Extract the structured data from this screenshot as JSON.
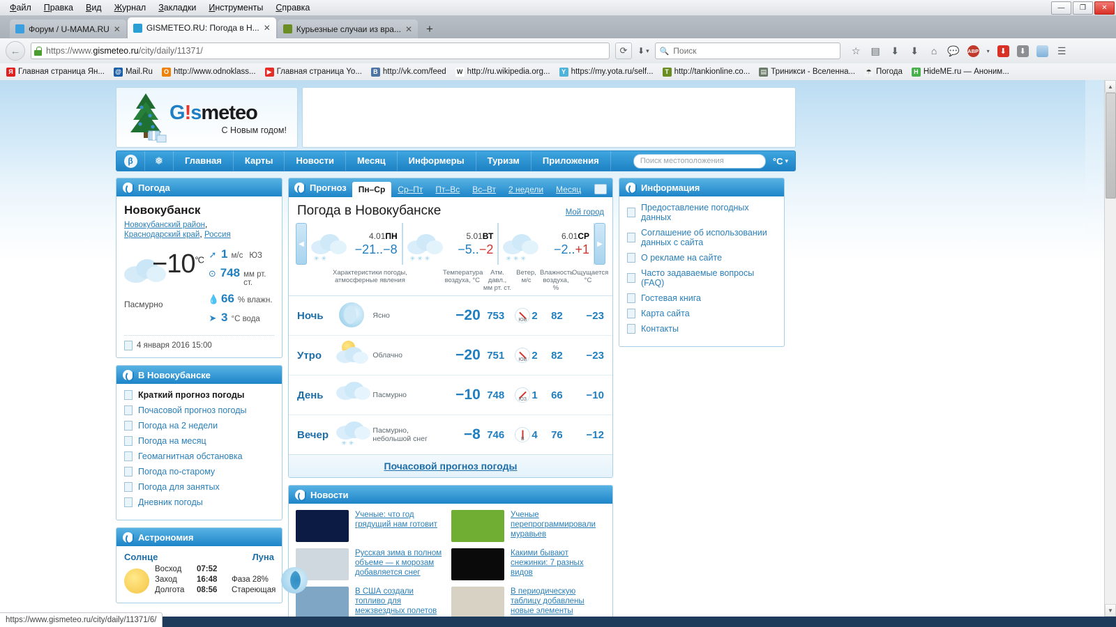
{
  "browser": {
    "menu": [
      "Файл",
      "Правка",
      "Вид",
      "Журнал",
      "Закладки",
      "Инструменты",
      "Справка"
    ],
    "window_buttons": {
      "minimize": "—",
      "maximize": "❐",
      "close": "✕"
    },
    "tabs": [
      {
        "title": "Форум / U-MAMA.RU",
        "active": false,
        "close": "✕"
      },
      {
        "title": "GISMETEO.RU: Погода в Н...",
        "active": true,
        "close": "✕"
      },
      {
        "title": "Курьезные случаи из вра...",
        "active": false,
        "close": "✕"
      }
    ],
    "new_tab_label": "+",
    "url_prefix": "https://www.",
    "url_domain": "gismeteo.ru",
    "url_path": "/city/daily/11371/",
    "reload_glyph": "⟳",
    "search_placeholder": "Поиск",
    "bookmarks": [
      {
        "label": "Главная страница Ян...",
        "badge": "Я",
        "color": "#e02020"
      },
      {
        "label": "Mail.Ru",
        "badge": "@",
        "color": "#1a5fa8"
      },
      {
        "label": "http://www.odnoklass...",
        "badge": "О",
        "color": "#ee8208"
      },
      {
        "label": "Главная страница Yo...",
        "badge": "▶",
        "color": "#e52d27"
      },
      {
        "label": "http://vk.com/feed",
        "badge": "B",
        "color": "#4c75a3"
      },
      {
        "label": "http://ru.wikipedia.org...",
        "badge": "W",
        "color": "#ffffff"
      },
      {
        "label": "https://my.yota.ru/self...",
        "badge": "Y",
        "color": "#4fb3d9"
      },
      {
        "label": "http://tankionline.co...",
        "badge": "T",
        "color": "#6b8e23"
      },
      {
        "label": "Триникси - Вселенна...",
        "badge": "▤",
        "color": "#6b7b6b"
      },
      {
        "label": "Погода",
        "badge": "☂",
        "color": "#f2f2f2"
      },
      {
        "label": "HideME.ru — Аноним...",
        "badge": "H",
        "color": "#46b04a"
      }
    ],
    "status_url": "https://www.gismeteo.ru/city/daily/11371/6/"
  },
  "site": {
    "logo": {
      "brand_gis": "G",
      "brand_bang": "!",
      "brand_s": "s",
      "brand_meteo": "meteo",
      "slogan": "С Новым годом!"
    },
    "nav": {
      "icon_beta": "β",
      "icon_snow": "❅",
      "items": [
        "Главная",
        "Карты",
        "Новости",
        "Месяц",
        "Информеры",
        "Туризм",
        "Приложения"
      ],
      "search_placeholder": "Поиск местоположения",
      "units": "°C",
      "units_caret": "▾"
    }
  },
  "left": {
    "weather_panel": {
      "title": "Погода",
      "city": "Новокубанск",
      "region_links": [
        "Новокубанский район",
        "Краснодарский край",
        "Россия"
      ],
      "temperature": "−10",
      "temperature_unit": "°C",
      "condition": "Пасмурно",
      "metrics": [
        {
          "icon": "wind-arrow-icon",
          "glyph": "➚",
          "value": "1",
          "unit": "м/с",
          "extra": "ЮЗ"
        },
        {
          "icon": "pressure-icon",
          "glyph": "⊙",
          "value": "748",
          "unit": "мм рт. ст.",
          "extra": ""
        },
        {
          "icon": "humidity-drop-icon",
          "glyph": "💧",
          "value": "66",
          "unit": "% влажн.",
          "extra": ""
        },
        {
          "icon": "water-fish-icon",
          "glyph": "➤",
          "value": "3",
          "unit": "°C вода",
          "extra": ""
        }
      ],
      "observed_at": "4 января 2016 15:00"
    },
    "city_panel": {
      "title": "В Новокубанске",
      "items": [
        {
          "label": "Краткий прогноз погоды",
          "current": true
        },
        {
          "label": "Почасовой прогноз погоды",
          "current": false
        },
        {
          "label": "Погода на 2 недели",
          "current": false
        },
        {
          "label": "Погода на месяц",
          "current": false
        },
        {
          "label": "Геомагнитная обстановка",
          "current": false
        },
        {
          "label": "Погода по-старому",
          "current": false
        },
        {
          "label": "Погода для занятых",
          "current": false
        },
        {
          "label": "Дневник погоды",
          "current": false
        }
      ]
    },
    "astronomy_panel": {
      "title": "Астрономия",
      "sun_label": "Солнце",
      "moon_label": "Луна",
      "rows": [
        {
          "label": "Восход",
          "time": "07:52",
          "note": ""
        },
        {
          "label": "Заход",
          "time": "16:48",
          "note": "Фаза 28%"
        },
        {
          "label": "Долгота",
          "time": "08:56",
          "note": "Стареющая"
        }
      ]
    }
  },
  "center": {
    "panel_title": "Прогноз",
    "tabs": [
      {
        "label": "Пн–Ср",
        "active": true
      },
      {
        "label": "Ср–Пт",
        "active": false
      },
      {
        "label": "Пт–Вс",
        "active": false
      },
      {
        "label": "Вс–Вт",
        "active": false
      },
      {
        "label": "2 недели",
        "active": false
      },
      {
        "label": "Месяц",
        "active": false
      }
    ],
    "heading": "Погода в Новокубанске",
    "my_city_link": "Мой город",
    "prev_arrow": "◀",
    "next_arrow": "▶",
    "days": [
      {
        "date": "4.01",
        "dow": "ПН",
        "tmin": "−21",
        "sep": "..",
        "tmax": "−8",
        "tmax_warm": false
      },
      {
        "date": "5.01",
        "dow": "ВТ",
        "tmin": "−5",
        "sep": "..",
        "tmax": "−2",
        "tmax_warm": true
      },
      {
        "date": "6.01",
        "dow": "СР",
        "tmin": "−2",
        "sep": "..",
        "tmax": "+1",
        "tmax_warm": true
      }
    ],
    "columns": {
      "desc": "Характеристики погоды,\nатмосферные явления",
      "desc_l1": "Характеристики погоды,",
      "desc_l2": "атмосферные явления",
      "temp_l1": "Температура",
      "temp_l2": "воздуха, °C",
      "press_l1": "Атм. давл.,",
      "press_l2": "мм рт. ст.",
      "wind_l1": "Ветер,",
      "wind_l2": "м/с",
      "hum_l1": "Влажность",
      "hum_l2": "воздуха, %",
      "feels_l1": "Ощущается",
      "feels_l2": "°C"
    },
    "rows": [
      {
        "part": "Ночь",
        "icon": "moon-clear-icon",
        "desc": "Ясно",
        "temp": "−20",
        "pressure": "753",
        "wind_dir": "ЮВ",
        "wind_speed": "2",
        "wind_deg": 225,
        "humidity": "82",
        "feels": "−23"
      },
      {
        "part": "Утро",
        "icon": "sun-cloud-icon",
        "desc": "Облачно",
        "temp": "−20",
        "pressure": "751",
        "wind_dir": "ЮВ",
        "wind_speed": "2",
        "wind_deg": 225,
        "humidity": "82",
        "feels": "−23"
      },
      {
        "part": "День",
        "icon": "cloud-icon",
        "desc": "Пасмурно",
        "temp": "−10",
        "pressure": "748",
        "wind_dir": "ЮЗ",
        "wind_speed": "1",
        "wind_deg": 135,
        "humidity": "66",
        "feels": "−10"
      },
      {
        "part": "Вечер",
        "icon": "cloud-snow-icon",
        "desc": "Пасмурно,\nнебольшой снег",
        "desc_l1": "Пасмурно,",
        "desc_l2": "небольшой снег",
        "temp": "−8",
        "pressure": "746",
        "wind_dir": "В",
        "wind_speed": "4",
        "wind_deg": 270,
        "humidity": "76",
        "feels": "−12"
      }
    ],
    "hourly_link": "Почасовой прогноз погоды",
    "news_title": "Новости",
    "news": [
      {
        "title": "Ученые: что год грядущий нам готовит",
        "thumb": "#0c1b44"
      },
      {
        "title": "Ученые перепрограммировали муравьев",
        "thumb": "#6fae32"
      },
      {
        "title": "Русская зима в полном объеме — к морозам добавляется снег",
        "thumb": "#cfd8de"
      },
      {
        "title": "Какими бывают снежинки: 7 разных видов",
        "thumb": "#0a0a0a"
      },
      {
        "title": "В США создали топливо для межзвездных полетов",
        "thumb": "#7fa6c4"
      },
      {
        "title": "В периодическую таблицу добавлены новые элементы",
        "thumb": "#d8d2c4"
      }
    ]
  },
  "right": {
    "info_panel": {
      "title": "Информация",
      "items": [
        "Предоставление погодных данных",
        "Соглашение об использовании данных с сайта",
        "О рекламе на сайте",
        "Часто задаваемые вопросы (FAQ)",
        "Гостевая книга",
        "Карта сайта",
        "Контакты"
      ]
    }
  },
  "colors": {
    "brand_blue": "#1e85c8",
    "panel_border": "#a9cfe6",
    "link": "#2a7fb8",
    "temp_blue": "#1f7fc0",
    "temp_red": "#d0342c"
  }
}
